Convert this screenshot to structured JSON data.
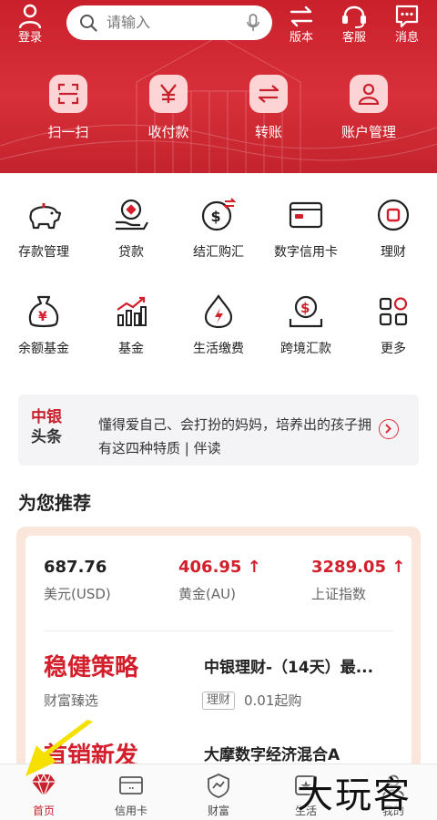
{
  "header": {
    "login_label": "登录",
    "search_placeholder": "请输入",
    "actions": [
      {
        "label": "版本",
        "icon": "switch-icon"
      },
      {
        "label": "客服",
        "icon": "headset-icon"
      },
      {
        "label": "消息",
        "icon": "message-icon"
      }
    ],
    "quick_actions": [
      {
        "label": "扫一扫",
        "icon": "scan-icon"
      },
      {
        "label": "收付款",
        "icon": "yen-icon"
      },
      {
        "label": "转账",
        "icon": "transfer-icon"
      },
      {
        "label": "账户管理",
        "icon": "account-icon"
      }
    ]
  },
  "services": [
    {
      "label": "存款管理",
      "icon": "piggy-bank-icon"
    },
    {
      "label": "贷款",
      "icon": "loan-icon"
    },
    {
      "label": "结汇购汇",
      "icon": "exchange-icon"
    },
    {
      "label": "数字信用卡",
      "icon": "credit-card-icon"
    },
    {
      "label": "理财",
      "icon": "wealth-icon"
    },
    {
      "label": "余额基金",
      "icon": "money-bag-icon"
    },
    {
      "label": "基金",
      "icon": "fund-chart-icon"
    },
    {
      "label": "生活缴费",
      "icon": "utility-icon"
    },
    {
      "label": "跨境汇款",
      "icon": "remittance-icon"
    },
    {
      "label": "更多",
      "icon": "more-icon"
    }
  ],
  "headline": {
    "logo_line1": "中银",
    "logo_line2": "头条",
    "text": "懂得爱自己、会打扮的妈妈，培养出的孩子拥有这四种特质 | 伴读"
  },
  "section_title": "为您推荐",
  "market": [
    {
      "value": "687.76",
      "name": "美元(USD)",
      "up": false
    },
    {
      "value": "406.95 ↑",
      "name": "黄金(AU)",
      "up": true
    },
    {
      "value": "3289.05 ↑",
      "name": "上证指数",
      "up": true
    }
  ],
  "recommend": [
    {
      "title": "稳健策略",
      "subtitle": "财富臻选",
      "product": "中银理财-（14天）最...",
      "tag": "理财",
      "min": "0.01起购"
    },
    {
      "title": "首销新发",
      "product": "大摩数字经济混合A"
    }
  ],
  "bottom_nav": [
    {
      "label": "首页",
      "icon": "home-diamond-icon",
      "active": true
    },
    {
      "label": "信用卡",
      "icon": "card-icon",
      "active": false
    },
    {
      "label": "财富",
      "icon": "wealth-shield-icon",
      "active": false
    },
    {
      "label": "生活",
      "icon": "life-icon",
      "active": false
    },
    {
      "label": "我的",
      "icon": "profile-icon",
      "active": false
    }
  ],
  "watermark": "大玩客",
  "colors": {
    "brand_red": "#c8202c",
    "accent_red": "#d21f2b",
    "arrow_yellow": "#f5e000"
  }
}
